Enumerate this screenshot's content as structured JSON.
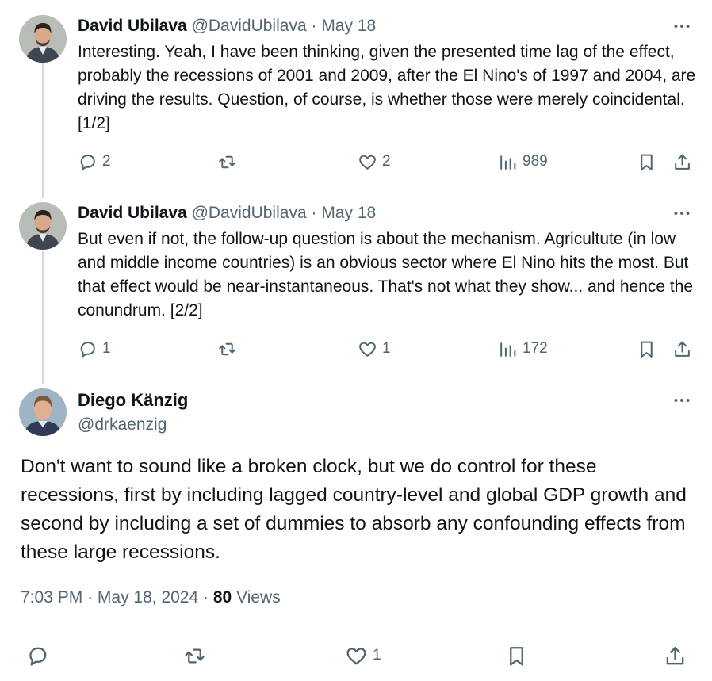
{
  "tweets": [
    {
      "author_name": "David Ubilava",
      "author_handle": "@DavidUbilava",
      "separator": "·",
      "date": "May 18",
      "text": "Interesting. Yeah, I have been thinking, given the presented time lag of the effect, probably the recessions of 2001 and 2009, after the El Nino's of 1997 and 2004, are driving the results. Question, of course, is whether those were merely coincidental. [1/2]",
      "replies": "2",
      "likes": "2",
      "views": "989"
    },
    {
      "author_name": "David Ubilava",
      "author_handle": "@DavidUbilava",
      "separator": "·",
      "date": "May 18",
      "text": "But even if not, the follow-up question is about the mechanism. Agricultute (in low and middle income countries) is an obvious sector where El Nino hits the most. But that effect would be near-instantaneous. That's not what they show... and hence the conundrum. [2/2]",
      "replies": "1",
      "likes": "1",
      "views": "172"
    }
  ],
  "main_tweet": {
    "author_name": "Diego Känzig",
    "author_handle": "@drkaenzig",
    "text": "Don't want to sound like a broken clock, but we do control for these recessions, first by including lagged country-level and global GDP growth and second by including a set of dummies to absorb any confounding effects from these large recessions.",
    "time": "7:03 PM",
    "separator": "·",
    "date": "May 18, 2024",
    "views_count": "80",
    "views_label": "Views",
    "likes": "1"
  },
  "icons": {
    "more": "more-dots-icon",
    "reply": "reply-icon",
    "retweet": "retweet-icon",
    "like": "heart-icon",
    "views": "views-chart-icon",
    "bookmark": "bookmark-icon",
    "share": "share-icon"
  },
  "colors": {
    "text": "#0f1419",
    "secondary": "#536471",
    "thread_line": "#cfd9de",
    "divider": "#eff3f4"
  }
}
